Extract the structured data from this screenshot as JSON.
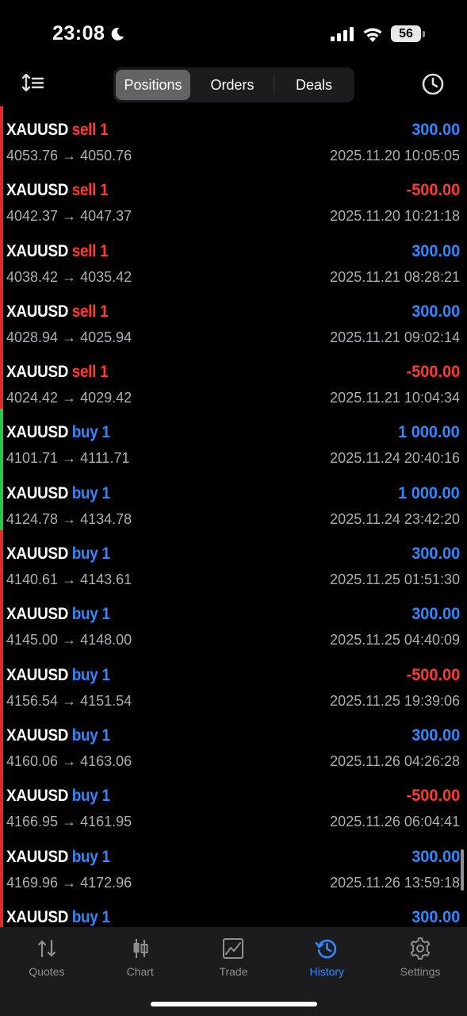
{
  "status_bar": {
    "time": "23:08",
    "battery": "56"
  },
  "header": {
    "tabs": [
      {
        "label": "Positions",
        "active": true
      },
      {
        "label": "Orders",
        "active": false
      },
      {
        "label": "Deals",
        "active": false
      }
    ]
  },
  "colors": {
    "sell": "#ff3b30",
    "buy": "#2f88ff",
    "profit_positive": "#2f88ff",
    "profit_negative": "#ff3b30",
    "bar_loss": "#e02b2b",
    "bar_win": "#2cc54a"
  },
  "positions": [
    {
      "symbol": "XAUUSD",
      "side": "sell 1",
      "profit": "300.00",
      "prices": "4053.76 → 4050.76",
      "time": "2025.11.20 10:05:05",
      "side_type": "sell",
      "profit_sign": "positive",
      "bar": "loss"
    },
    {
      "symbol": "XAUUSD",
      "side": "sell 1",
      "profit": "-500.00",
      "prices": "4042.37 → 4047.37",
      "time": "2025.11.20 10:21:18",
      "side_type": "sell",
      "profit_sign": "negative",
      "bar": "loss"
    },
    {
      "symbol": "XAUUSD",
      "side": "sell 1",
      "profit": "300.00",
      "prices": "4038.42 → 4035.42",
      "time": "2025.11.21 08:28:21",
      "side_type": "sell",
      "profit_sign": "positive",
      "bar": "loss"
    },
    {
      "symbol": "XAUUSD",
      "side": "sell 1",
      "profit": "300.00",
      "prices": "4028.94 → 4025.94",
      "time": "2025.11.21 09:02:14",
      "side_type": "sell",
      "profit_sign": "positive",
      "bar": "loss"
    },
    {
      "symbol": "XAUUSD",
      "side": "sell 1",
      "profit": "-500.00",
      "prices": "4024.42 → 4029.42",
      "time": "2025.11.21 10:04:34",
      "side_type": "sell",
      "profit_sign": "negative",
      "bar": "loss"
    },
    {
      "symbol": "XAUUSD",
      "side": "buy 1",
      "profit": "1 000.00",
      "prices": "4101.71 → 4111.71",
      "time": "2025.11.24 20:40:16",
      "side_type": "buy",
      "profit_sign": "positive",
      "bar": "win"
    },
    {
      "symbol": "XAUUSD",
      "side": "buy 1",
      "profit": "1 000.00",
      "prices": "4124.78 → 4134.78",
      "time": "2025.11.24 23:42:20",
      "side_type": "buy",
      "profit_sign": "positive",
      "bar": "win"
    },
    {
      "symbol": "XAUUSD",
      "side": "buy 1",
      "profit": "300.00",
      "prices": "4140.61 → 4143.61",
      "time": "2025.11.25 01:51:30",
      "side_type": "buy",
      "profit_sign": "positive",
      "bar": "loss"
    },
    {
      "symbol": "XAUUSD",
      "side": "buy 1",
      "profit": "300.00",
      "prices": "4145.00 → 4148.00",
      "time": "2025.11.25 04:40:09",
      "side_type": "buy",
      "profit_sign": "positive",
      "bar": "loss"
    },
    {
      "symbol": "XAUUSD",
      "side": "buy 1",
      "profit": "-500.00",
      "prices": "4156.54 → 4151.54",
      "time": "2025.11.25 19:39:06",
      "side_type": "buy",
      "profit_sign": "negative",
      "bar": "loss"
    },
    {
      "symbol": "XAUUSD",
      "side": "buy 1",
      "profit": "300.00",
      "prices": "4160.06 → 4163.06",
      "time": "2025.11.26 04:26:28",
      "side_type": "buy",
      "profit_sign": "positive",
      "bar": "loss"
    },
    {
      "symbol": "XAUUSD",
      "side": "buy 1",
      "profit": "-500.00",
      "prices": "4166.95 → 4161.95",
      "time": "2025.11.26 06:04:41",
      "side_type": "buy",
      "profit_sign": "negative",
      "bar": "loss"
    },
    {
      "symbol": "XAUUSD",
      "side": "buy 1",
      "profit": "300.00",
      "prices": "4169.96 → 4172.96",
      "time": "2025.11.26 13:59:18",
      "side_type": "buy",
      "profit_sign": "positive",
      "bar": "loss"
    },
    {
      "symbol": "XAUUSD",
      "side": "buy 1",
      "profit": "300.00",
      "prices": "",
      "time": "",
      "side_type": "buy",
      "profit_sign": "positive",
      "bar": "loss"
    }
  ],
  "tabbar": {
    "items": [
      {
        "label": "Quotes",
        "icon": "quotes-icon",
        "active": false
      },
      {
        "label": "Chart",
        "icon": "chart-icon",
        "active": false
      },
      {
        "label": "Trade",
        "icon": "trade-icon",
        "active": false
      },
      {
        "label": "History",
        "icon": "history-icon",
        "active": true
      },
      {
        "label": "Settings",
        "icon": "settings-icon",
        "active": false
      }
    ]
  }
}
